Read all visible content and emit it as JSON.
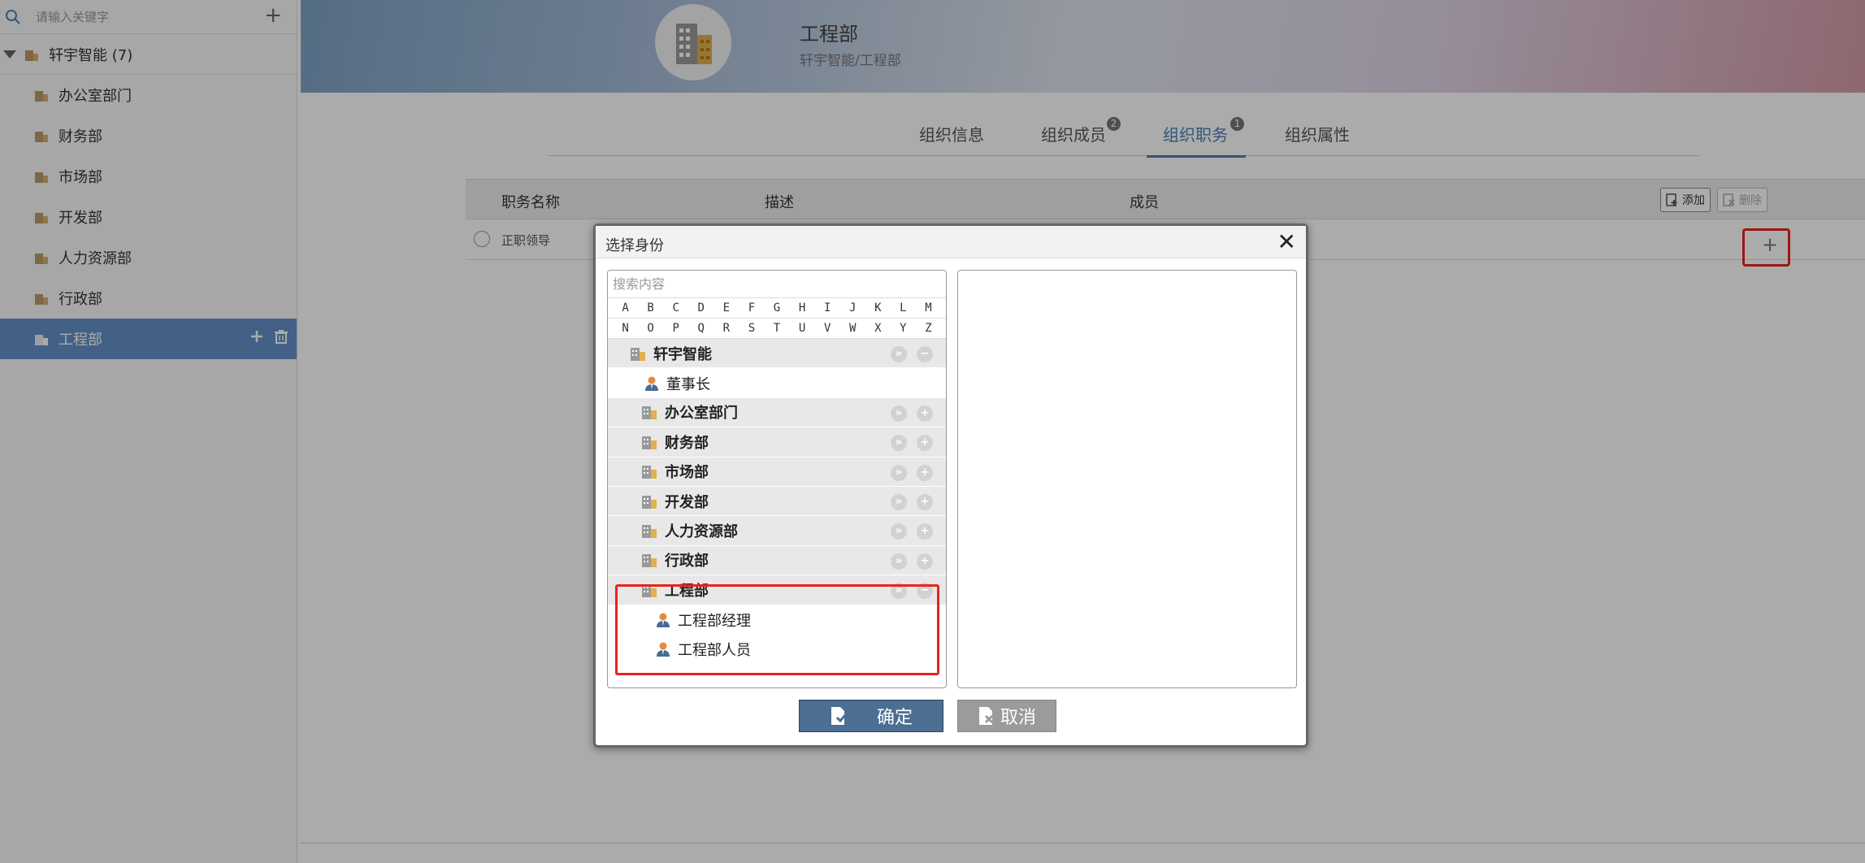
{
  "sidebar": {
    "search_placeholder": "请输入关键字",
    "root": {
      "label": "轩宇智能 (7)"
    },
    "items": [
      {
        "label": "办公室部门"
      },
      {
        "label": "财务部"
      },
      {
        "label": "市场部"
      },
      {
        "label": "开发部"
      },
      {
        "label": "人力资源部"
      },
      {
        "label": "行政部"
      },
      {
        "label": "工程部",
        "selected": true
      }
    ]
  },
  "header": {
    "title": "工程部",
    "subtitle": "轩宇智能/工程部"
  },
  "tabs": [
    {
      "label": "组织信息"
    },
    {
      "label": "组织成员",
      "badge": "2"
    },
    {
      "label": "组织职务",
      "badge": "1",
      "active": true
    },
    {
      "label": "组织属性"
    }
  ],
  "table": {
    "columns": [
      "职务名称",
      "描述",
      "成员"
    ],
    "add_label": "添加",
    "delete_label": "删除",
    "rows": [
      {
        "name": "正职领导"
      }
    ]
  },
  "dialog": {
    "title": "选择身份",
    "close": "✕",
    "search_placeholder": "搜索内容",
    "alpha_row1": [
      "A",
      "B",
      "C",
      "D",
      "E",
      "F",
      "G",
      "H",
      "I",
      "J",
      "K",
      "L",
      "M"
    ],
    "alpha_row2": [
      "N",
      "O",
      "P",
      "Q",
      "R",
      "S",
      "T",
      "U",
      "V",
      "W",
      "X",
      "Y",
      "Z"
    ],
    "tree": {
      "root": "轩宇智能",
      "root_person": "董事长",
      "departments": [
        "办公室部门",
        "财务部",
        "市场部",
        "开发部",
        "人力资源部",
        "行政部",
        "工程部"
      ],
      "expanded_people": [
        "工程部经理",
        "工程部人员"
      ]
    },
    "ok_label": "确定",
    "cancel_label": "取消"
  },
  "colors": {
    "accent": "#4a7fb4",
    "selected": "#6591c8",
    "highlight": "#e8231f",
    "ok": "#4d6e93"
  }
}
